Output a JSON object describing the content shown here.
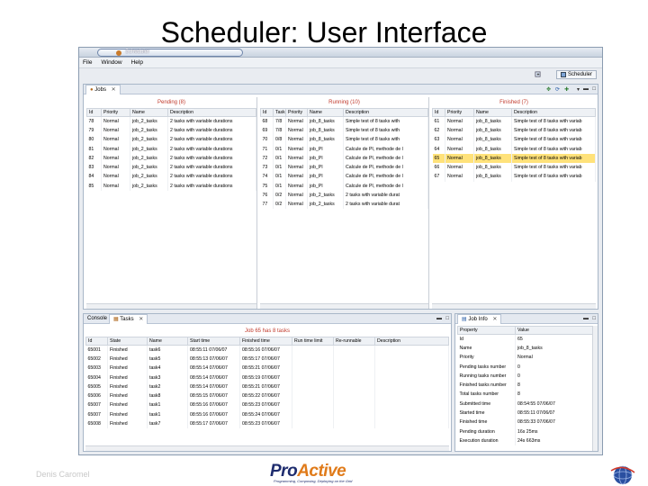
{
  "slide": {
    "title": "Scheduler: User Interface",
    "footer_author": "Denis Caromel"
  },
  "logo": {
    "text_pro": "Pro",
    "text_active": "Active",
    "tagline": "Programming, Composing, Deploying on the Grid"
  },
  "window": {
    "title": "Scheduler",
    "menu": [
      "File",
      "Window",
      "Help"
    ],
    "perspective_label": "Scheduler",
    "jobs_tab": "Jobs"
  },
  "pending": {
    "title": "Pending (8)",
    "columns": [
      "Id",
      "Priority",
      "Name",
      "Description"
    ],
    "rows": [
      [
        "78",
        "Normal",
        "job_2_tasks",
        "2 tasks with variable durations"
      ],
      [
        "79",
        "Normal",
        "job_2_tasks",
        "2 tasks with variable durations"
      ],
      [
        "80",
        "Normal",
        "job_2_tasks",
        "2 tasks with variable durations"
      ],
      [
        "81",
        "Normal",
        "job_2_tasks",
        "2 tasks with variable durations"
      ],
      [
        "82",
        "Normal",
        "job_2_tasks",
        "2 tasks with variable durations"
      ],
      [
        "83",
        "Normal",
        "job_2_tasks",
        "2 tasks with variable durations"
      ],
      [
        "84",
        "Normal",
        "job_2_tasks",
        "2 tasks with variable durations"
      ],
      [
        "85",
        "Normal",
        "job_2_tasks",
        "2 tasks with variable durations"
      ]
    ]
  },
  "running": {
    "title": "Running (10)",
    "columns": [
      "Id",
      "Task",
      "Priority",
      "Name",
      "Description"
    ],
    "rows": [
      [
        "68",
        "7/8",
        "Normal",
        "job_8_tasks",
        "Simple test of 8 tasks with"
      ],
      [
        "69",
        "7/8",
        "Normal",
        "job_8_tasks",
        "Simple test of 8 tasks with"
      ],
      [
        "70",
        "0/8",
        "Normal",
        "job_8_tasks",
        "Simple test of 8 tasks with"
      ],
      [
        "71",
        "0/1",
        "Normal",
        "job_PI",
        "Calcule de PI, methode de l"
      ],
      [
        "72",
        "0/1",
        "Normal",
        "job_PI",
        "Calcule de PI, methode de l"
      ],
      [
        "73",
        "0/1",
        "Normal",
        "job_PI",
        "Calcule de PI, methode de l"
      ],
      [
        "74",
        "0/1",
        "Normal",
        "job_PI",
        "Calcule de PI, methode de l"
      ],
      [
        "75",
        "0/1",
        "Normal",
        "job_PI",
        "Calcule de PI, methode de l"
      ],
      [
        "76",
        "0/2",
        "Normal",
        "job_2_tasks",
        "2 tasks with variable durat"
      ],
      [
        "77",
        "0/2",
        "Normal",
        "job_2_tasks",
        "2 tasks with variable durat"
      ]
    ]
  },
  "finished": {
    "title": "Finished (7)",
    "columns": [
      "Id",
      "Priority",
      "Name",
      "Description"
    ],
    "selected_index": 4,
    "rows": [
      [
        "61",
        "Normal",
        "job_8_tasks",
        "Simple test of 8 tasks with variab"
      ],
      [
        "62",
        "Normal",
        "job_8_tasks",
        "Simple test of 8 tasks with variab"
      ],
      [
        "63",
        "Normal",
        "job_8_tasks",
        "Simple test of 8 tasks with variab"
      ],
      [
        "64",
        "Normal",
        "job_8_tasks",
        "Simple test of 8 tasks with variab"
      ],
      [
        "65",
        "Normal",
        "job_8_tasks",
        "Simple test of 8 tasks with variab"
      ],
      [
        "66",
        "Normal",
        "job_8_tasks",
        "Simple test of 8 tasks with variab"
      ],
      [
        "67",
        "Normal",
        "job_8_tasks",
        "Simple test of 8 tasks with variab"
      ]
    ]
  },
  "tasks_panel": {
    "tab_console": "Console",
    "tab_tasks": "Tasks",
    "title": "Job 65 has 8 tasks",
    "columns": [
      "Id",
      "State",
      "Name",
      "Start time",
      "Finished time",
      "Run time limit",
      "Re-runnable",
      "Description"
    ],
    "rows": [
      [
        "65001",
        "Finished",
        "task6",
        "08:55:11  07/06/07",
        "08:55:16  07/06/07",
        "",
        "",
        ""
      ],
      [
        "65002",
        "Finished",
        "task5",
        "08:55:13  07/06/07",
        "08:55:17  07/06/07",
        "",
        "",
        ""
      ],
      [
        "65003",
        "Finished",
        "task4",
        "08:55:14  07/06/07",
        "08:55:21  07/06/07",
        "",
        "",
        ""
      ],
      [
        "65004",
        "Finished",
        "task3",
        "08:55:14  07/06/07",
        "08:55:19  07/06/07",
        "",
        "",
        ""
      ],
      [
        "65005",
        "Finished",
        "task2",
        "08:55:14  07/06/07",
        "08:55:21  07/06/07",
        "",
        "",
        ""
      ],
      [
        "65006",
        "Finished",
        "task8",
        "08:55:15  07/06/07",
        "08:55:22  07/06/07",
        "",
        "",
        ""
      ],
      [
        "65007",
        "Finished",
        "task1",
        "08:55:16  07/06/07",
        "08:55:23  07/06/07",
        "",
        "",
        ""
      ],
      [
        "65007",
        "Finished",
        "task1",
        "08:55:16  07/06/07",
        "08:55:24  07/06/07",
        "",
        "",
        ""
      ],
      [
        "65008",
        "Finished",
        "task7",
        "08:55:17  07/06/07",
        "08:55:23  07/06/07",
        "",
        "",
        ""
      ]
    ]
  },
  "jobinfo_panel": {
    "tab": "Job Info",
    "columns": [
      "Property",
      "Value"
    ],
    "rows": [
      [
        "Id",
        "65"
      ],
      [
        "Name",
        "job_8_tasks"
      ],
      [
        "Priority",
        "Normal"
      ],
      [
        "Pending tasks number",
        "0"
      ],
      [
        "Running tasks number",
        "0"
      ],
      [
        "Finished tasks number",
        "8"
      ],
      [
        "Total tasks number",
        "8"
      ],
      [
        "Submitted time",
        "08:54:55  07/06/07"
      ],
      [
        "Started time",
        "08:55:11  07/06/07"
      ],
      [
        "Finished time",
        "08:55:33  07/06/07"
      ],
      [
        "Pending duration",
        "16s 25ms"
      ],
      [
        "Execution duration",
        "24s 663ms"
      ]
    ]
  },
  "colors": {
    "section_title": "#c0392b",
    "selected_row": "#ffe27a",
    "logo_blue": "#1e2c6e"
  }
}
